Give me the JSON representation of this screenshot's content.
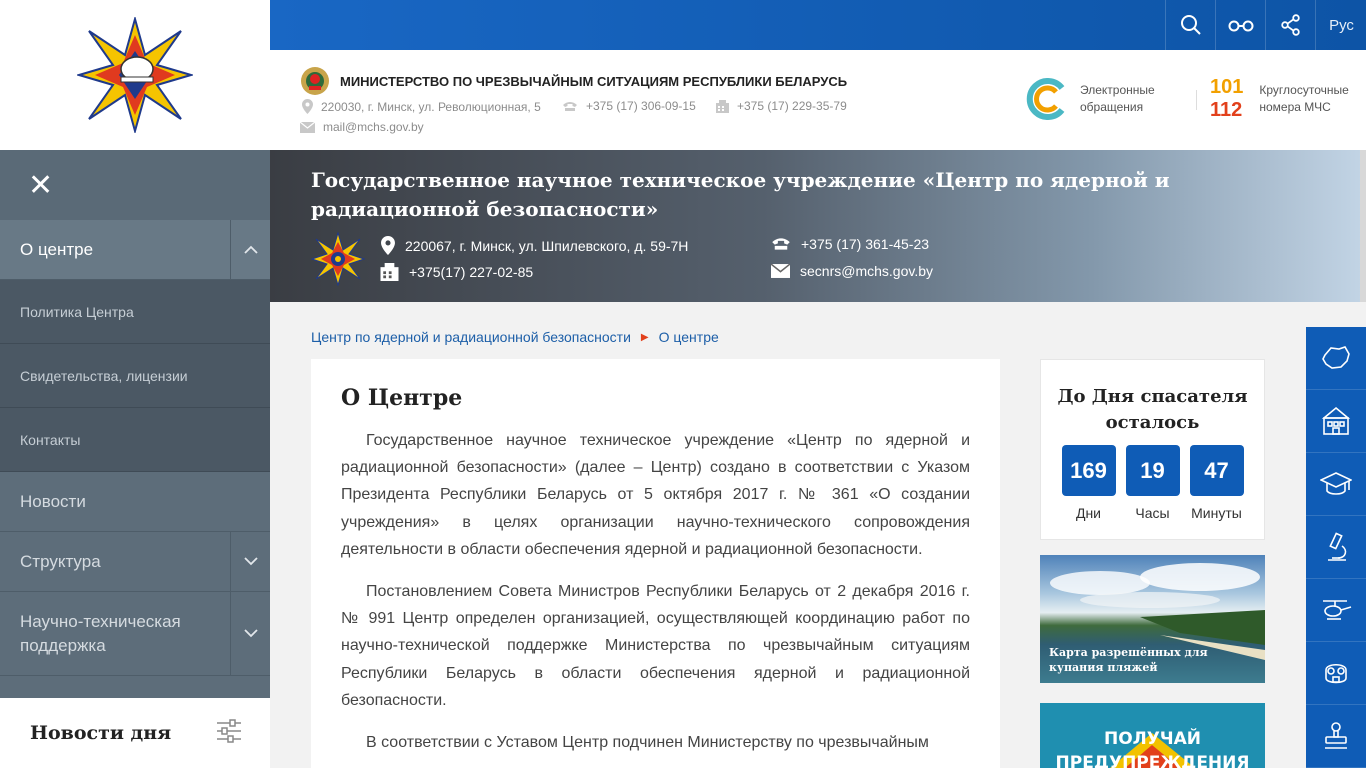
{
  "logo": {
    "icon": "mchs-emblem-icon"
  },
  "sidebar": {
    "close_icon": "close-icon",
    "items": [
      {
        "label": "О центре",
        "state": "expanded"
      },
      {
        "label": "Политика Центра"
      },
      {
        "label": "Свидетельства, лицензии"
      },
      {
        "label": "Контакты"
      },
      {
        "label": "Новости"
      },
      {
        "label": "Структура"
      },
      {
        "label": "Научно-техническая поддержка"
      }
    ],
    "news_day": "Новости дня"
  },
  "topbar": {
    "icons": [
      "search-icon",
      "glasses-icon",
      "share-icon"
    ],
    "lang": "Рус"
  },
  "header": {
    "ministry": "МИНИСТЕРСТВО ПО ЧРЕЗВЫЧАЙНЫМ СИТУАЦИЯМ РЕСПУБЛИКИ БЕЛАРУСЬ",
    "address": "220030, г. Минск, ул. Революционная, 5",
    "phone": "+375 (17) 306-09-15",
    "fax": "+375 (17) 229-35-79",
    "email": "mail@mchs.gov.by",
    "e_appeals": "Электронные обращения",
    "hotline_1": "101",
    "hotline_2": "112",
    "hotline_label": "Круглосуточные номера МЧС"
  },
  "banner": {
    "title": "Государственное научное техническое учреждение «Центр по ядерной и радиационной безопасности»",
    "address": "220067, г. Минск, ул. Шпилевского, д. 59-7Н",
    "fax": "+375(17) 227-02-85",
    "phone": "+375 (17) 361-45-23",
    "email": "secnrs@mchs.gov.by"
  },
  "breadcrumb": {
    "parent": "Центр по ядерной и радиационной безопасности",
    "current": "О центре"
  },
  "article": {
    "title": "О Центре",
    "p1": "Государственное научное техническое учреждение «Центр по ядерной и радиационной безопасности» (далее – Центр) создано в соответствии с Указом Президента Республики Беларусь от 5 октября 2017 г. № 361 «О создании учреждения» в целях организации научно-технического сопровождения деятельности в области обеспечения ядерной и радиационной безопасности.",
    "p2": "Постановлением Совета Министров Республики Беларусь от 2 декабря 2016 г. № 991 Центр определен организацией, осуществляющей координацию работ по научно-технической поддержке Министерства по чрезвычайным ситуациям Республики Беларусь в области обеспечения ядерной и радиационной безопасности.",
    "p3": "В соответствии с Уставом Центр подчинен Министерству по чрезвычайным"
  },
  "countdown": {
    "title": "До Дня спасателя осталось",
    "days": "169",
    "days_label": "Дни",
    "hours": "19",
    "hours_label": "Часы",
    "minutes": "47",
    "minutes_label": "Минуты"
  },
  "promos": {
    "beaches": "Карта разрешённых для купания пляжей",
    "warnings": "ПОЛУЧАЙ ПРЕДУПРЕЖДЕНИЯ"
  },
  "rail": {
    "icons": [
      "belarus-map-icon",
      "building-icon",
      "graduation-cap-icon",
      "microscope-icon",
      "helicopter-icon",
      "gas-mask-icon",
      "stamp-icon"
    ]
  },
  "colors": {
    "brand_blue": "#0f5cb6",
    "accent_orange": "#f2a000",
    "accent_red": "#e2401b",
    "sidebar": "#5d6d7a"
  }
}
